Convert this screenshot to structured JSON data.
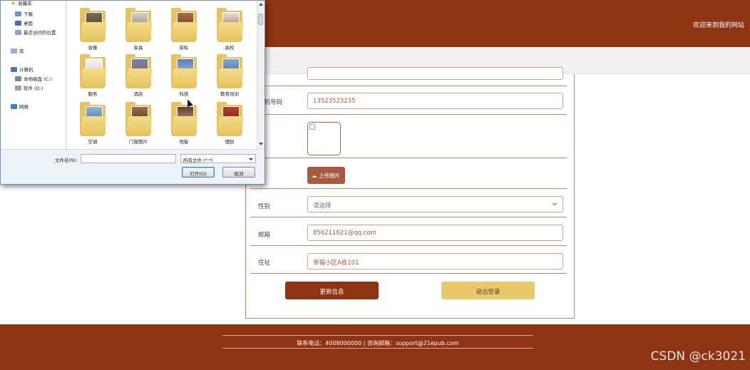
{
  "header": {
    "welcome": "欢迎来到我的网站"
  },
  "form": {
    "phone_label": "手机号码",
    "phone_value": "13523523235",
    "upload_label": "上传图片",
    "gender_label": "性别",
    "gender_value": "请选择",
    "email_label": "邮箱",
    "email_value": "856211621@qq.com",
    "address_label": "住址",
    "address_value": "幸福小区A栋101",
    "update_button": "更新信息",
    "logout_button": "退出登录"
  },
  "footer": {
    "text": "联系电话：4008000000 | 咨询邮箱：support@21epub.com"
  },
  "watermark": "CSDN @ck3021",
  "dialog": {
    "nav": {
      "favorites": "收藏夹",
      "downloads": "下载",
      "desktop": "桌面",
      "recent": "最近访问的位置",
      "libraries": "库",
      "computer": "计算机",
      "drive_c": "本地磁盘 (C:)",
      "drive_d": "软件 (D:)",
      "network": "网络"
    },
    "folders": [
      "音像",
      "家具",
      "家私",
      "高校",
      "服务",
      "酒店",
      "科技",
      "教育培训",
      "空调",
      "门窗图片",
      "地板",
      "理财"
    ],
    "filename_label": "文件名(N):",
    "filename_value": "",
    "filter_value": "所有文件 (*.*)",
    "open_button": "打开(O)",
    "cancel_button": "取消"
  },
  "colors": {
    "brand": "#8f3412",
    "logout": "#e8c96c",
    "upload": "#a75a3e"
  }
}
